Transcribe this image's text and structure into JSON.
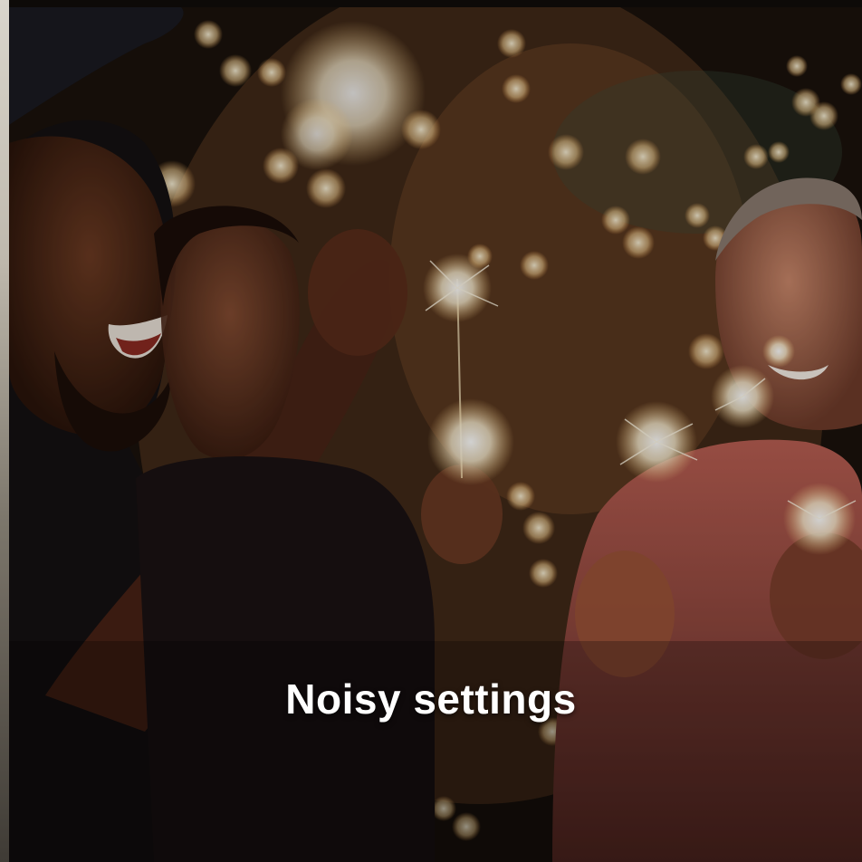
{
  "slide": {
    "caption": "Noisy settings"
  },
  "image": {
    "description_icon": "party-sparklers-photo-icon"
  },
  "colors": {
    "caption_text": "#ffffff",
    "warm_glow": "#f2b36a",
    "background_dark": "#0d0a08"
  }
}
